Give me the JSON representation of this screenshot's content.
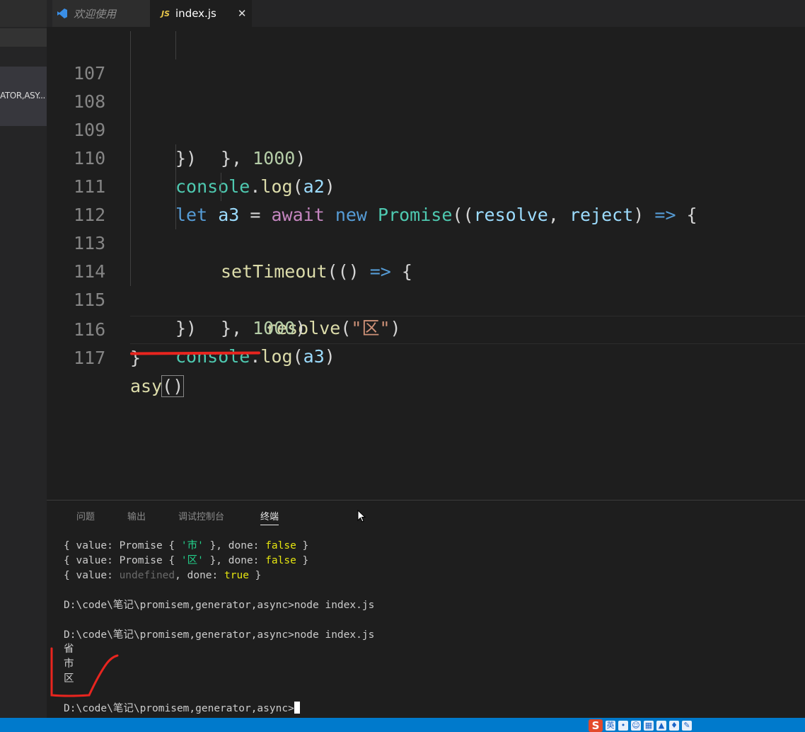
{
  "tabs": {
    "welcome_label": "欢迎使用",
    "file_label": "index.js",
    "file_icon": "JS",
    "close_glyph": "✕"
  },
  "sidebar": {
    "item_label": "ATOR,ASY..."
  },
  "editor": {
    "lines": [
      {
        "n": "107"
      },
      {
        "n": "108"
      },
      {
        "n": "109"
      },
      {
        "n": "110"
      },
      {
        "n": "111"
      },
      {
        "n": "112"
      },
      {
        "n": "113"
      },
      {
        "n": "114"
      },
      {
        "n": "115"
      },
      {
        "n": "116"
      },
      {
        "n": "117"
      }
    ],
    "tokens": {
      "close_timeout": "}, ",
      "delay": "1000",
      "close_paren": ")",
      "close_promise": "})",
      "console": "console",
      "dot": ".",
      "log": "log",
      "open_paren": "(",
      "a2": "a2",
      "a3": "a3",
      "let": "let",
      "eq": " = ",
      "await": "await",
      "new": "new",
      "promise": "Promise",
      "open_args": "((",
      "resolve": "resolve",
      "comma": ", ",
      "reject": "reject",
      "close_args": ") ",
      "arrow": "=>",
      "open_brace": " {",
      "settimeout": "setTimeout",
      "empty_parens": "(() ",
      "str_qu": "\"区\"",
      "fn_close": "}",
      "asy": "asy",
      "parens": "()"
    }
  },
  "panel": {
    "tabs": [
      "问题",
      "输出",
      "调试控制台",
      "终端"
    ],
    "active_tab": "终端",
    "output": {
      "obj_open": "{ value: Promise { ",
      "shi": "'市'",
      "qu": "'区'",
      "mid": " }, done: ",
      "false": "false",
      "close": " }",
      "value_prefix": "{ value: ",
      "undefined": "undefined",
      "done_prefix": ", done: ",
      "true": "true",
      "prompt1": "D:\\code\\笔记\\promisem,generator,async>node index.js",
      "prompt2": "D:\\code\\笔记\\promisem,generator,async>node index.js",
      "result": [
        "省",
        "市",
        "区"
      ],
      "prompt3": "D:\\code\\笔记\\promisem,generator,async>"
    }
  },
  "ime": {
    "logo": "S",
    "mode": "英"
  },
  "colors": {
    "annotation_red": "#e8251f",
    "status_blue": "#007acc",
    "keyword": "#569cd6",
    "control": "#c586c0",
    "string": "#ce9178"
  }
}
